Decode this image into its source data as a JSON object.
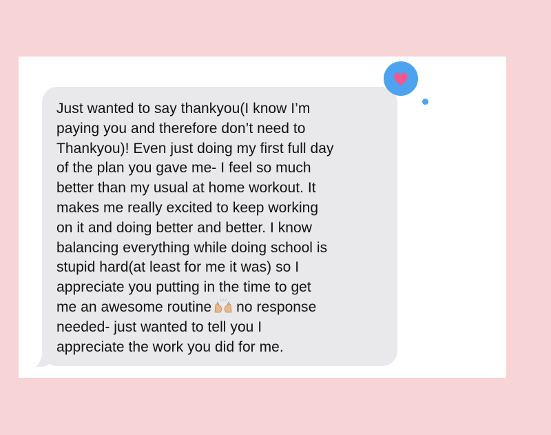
{
  "message": {
    "lines": [
      "Just wanted to say thankyou(I know I’m",
      "paying you and therefore don’t need to",
      "Thankyou)! Even just doing my first full day",
      "of the plan you gave me- I feel so much",
      "better than my usual at home workout. It",
      "makes me really excited to keep working",
      "on it and doing better and better. I know",
      "balancing everything while doing school is",
      "stupid hard(at least for me it was) so I",
      "appreciate you putting in the time to get",
      "me an awesome routine",
      "no response",
      "needed- just wanted to tell you I",
      "appreciate the work you did for me."
    ],
    "emoji": "raised-hands-icon",
    "bubble_color": "#e9e9eb"
  },
  "reaction": {
    "icon": "heart-icon",
    "badge_color": "#4da3ef",
    "heart_color": "#f2578f"
  },
  "colors": {
    "background": "#f7d4d5",
    "card": "#ffffff",
    "text": "#111111"
  }
}
